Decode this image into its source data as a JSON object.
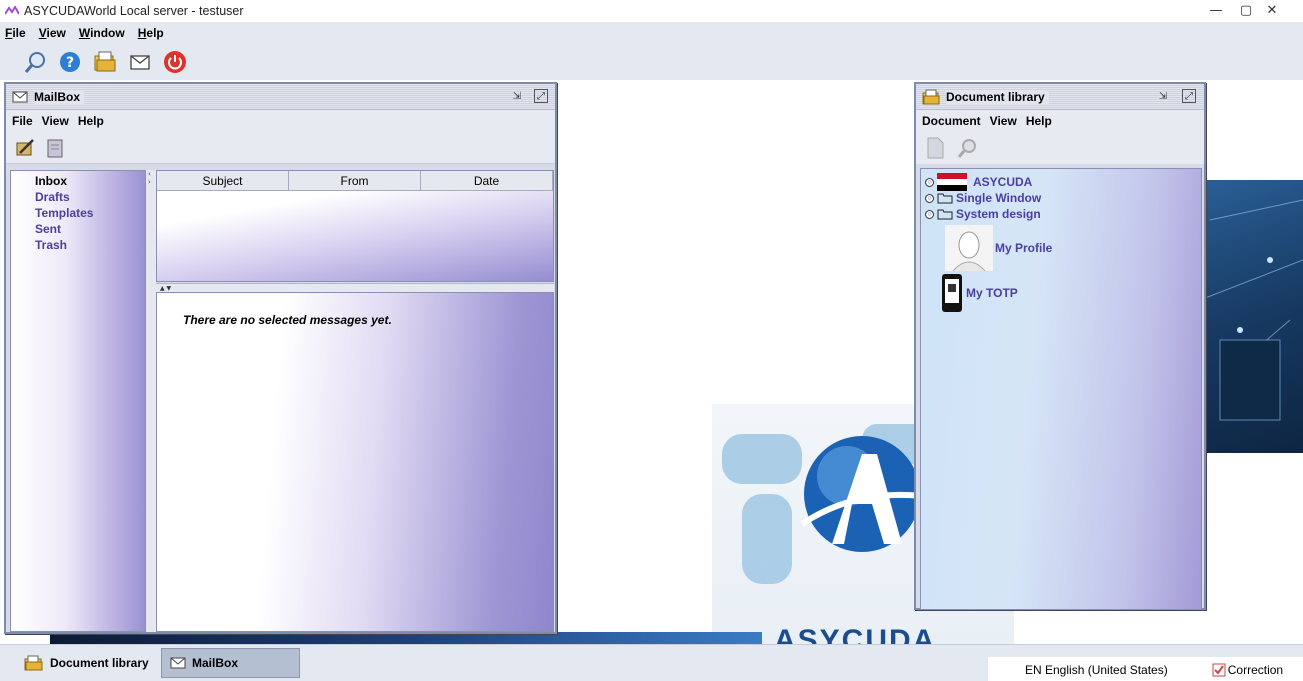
{
  "window": {
    "title": "ASYCUDAWorld Local server - testuser",
    "controls": {
      "minimize": "—",
      "maximize": "▢",
      "close": "✕"
    }
  },
  "menubar": {
    "items": [
      "File",
      "View",
      "Window",
      "Help"
    ]
  },
  "toolbar": {
    "buttons": [
      "search-icon",
      "help-icon",
      "document-library-icon",
      "mail-icon",
      "power-icon"
    ]
  },
  "mailbox": {
    "title": "MailBox",
    "menu": [
      "File",
      "View",
      "Help"
    ],
    "folders": [
      "Inbox",
      "Drafts",
      "Templates",
      "Sent",
      "Trash"
    ],
    "selected_folder": "Inbox",
    "columns": [
      "Subject",
      "From",
      "Date"
    ],
    "empty_message": "There are no selected messages yet."
  },
  "doclib": {
    "title": "Document library",
    "menu": [
      "Document",
      "View",
      "Help"
    ],
    "tree": {
      "asycuda": "ASYCUDA",
      "single_window": "Single Window",
      "system_design": "System design",
      "my_profile": "My Profile",
      "my_totp": "My TOTP"
    }
  },
  "background": {
    "logo_text": "ASYCUDA"
  },
  "taskbar": {
    "tasks": [
      "Document library",
      "MailBox"
    ],
    "language": "EN English (United States)",
    "correction": "Correction"
  },
  "colors": {
    "accent": "#4b3fa0",
    "frame_border": "#7b8cad",
    "menubar_bg": "#e4e8f1"
  }
}
